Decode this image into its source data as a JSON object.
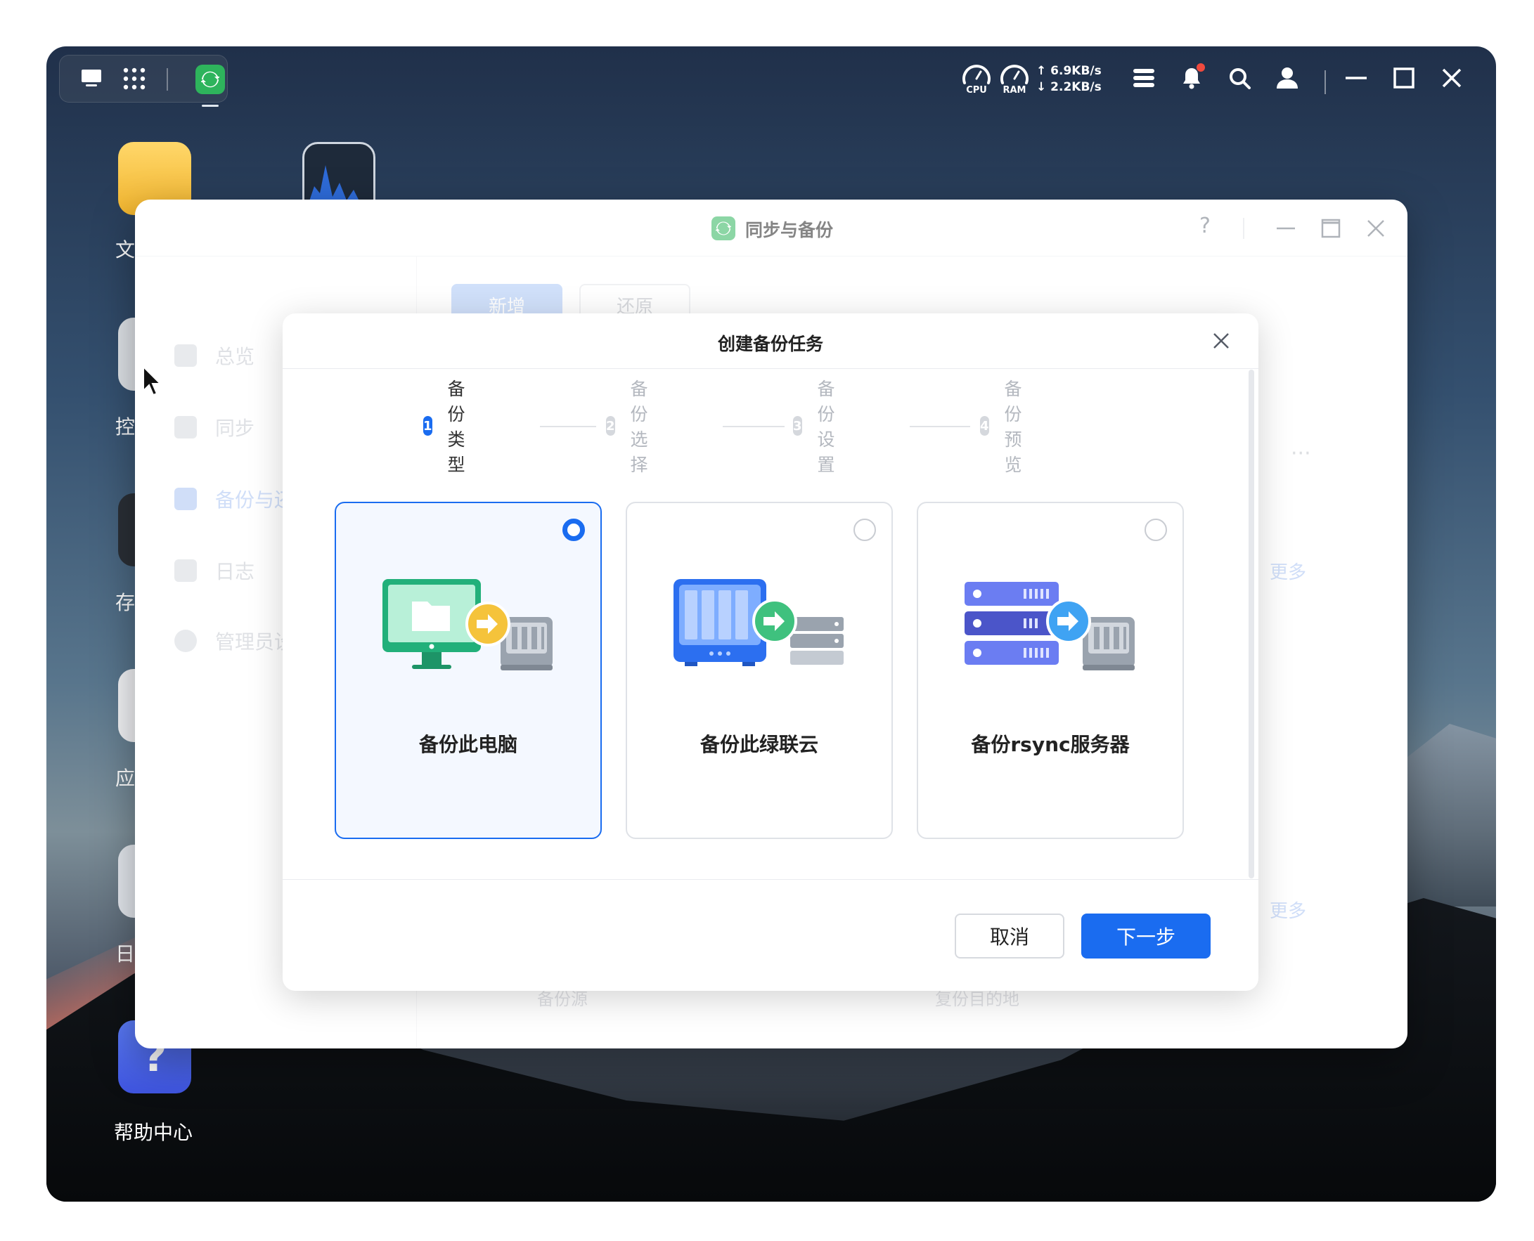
{
  "topbar": {
    "cpu_label": "CPU",
    "ram_label": "RAM",
    "upload_speed": "↑ 6.9KB/s",
    "download_speed": "↓ 2.2KB/s"
  },
  "desktop": {
    "icons": [
      {
        "label": "文"
      },
      {
        "label": "控"
      },
      {
        "label": "存"
      },
      {
        "label": "应"
      },
      {
        "label": "日"
      },
      {
        "label": "帮助中心"
      }
    ]
  },
  "app": {
    "title": "同步与备份",
    "help": "?",
    "sidebar": [
      {
        "label": "总览"
      },
      {
        "label": "同步"
      },
      {
        "label": "备份与还"
      },
      {
        "label": "日志"
      },
      {
        "label": "管理员设"
      }
    ],
    "tabs": [
      {
        "label": "新增"
      },
      {
        "label": "还原"
      }
    ],
    "more_links": [
      "更多",
      "更多"
    ],
    "ellipsis": "···",
    "bottom_cols": [
      "备份源",
      "复份目的地"
    ]
  },
  "modal": {
    "title": "创建备份任务",
    "steps": [
      {
        "num": "1",
        "label": "备份类型",
        "active": true
      },
      {
        "num": "2",
        "label": "备份选择",
        "active": false
      },
      {
        "num": "3",
        "label": "备份设置",
        "active": false
      },
      {
        "num": "4",
        "label": "备份预览",
        "active": false
      }
    ],
    "options": [
      {
        "label": "备份此电脑",
        "selected": true,
        "art": "computer-to-nas-icon"
      },
      {
        "label": "备份此绿联云",
        "selected": false,
        "art": "nas-to-server-icon"
      },
      {
        "label": "备份rsync服务器",
        "selected": false,
        "art": "rsync-server-to-nas-icon"
      }
    ],
    "cancel_label": "取消",
    "next_label": "下一步"
  },
  "colors": {
    "accent": "#1a6cf0",
    "brand_green": "#2eb45c"
  }
}
